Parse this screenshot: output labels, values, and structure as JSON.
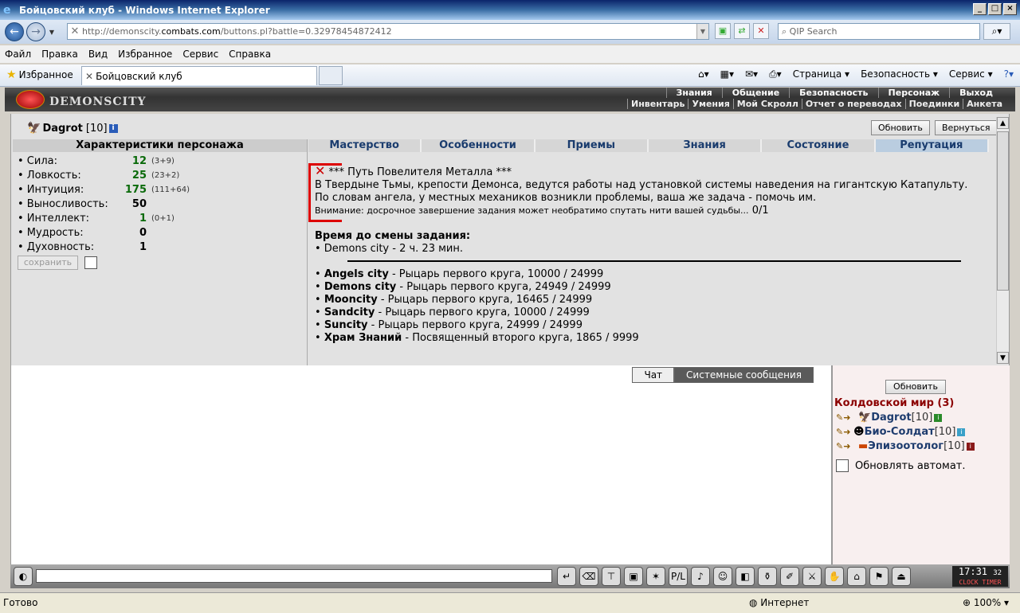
{
  "window": {
    "title": "Бойцовский клуб - Windows Internet Explorer"
  },
  "address": {
    "url_prefix": "http://demonscity.",
    "url_domain": "combats.com",
    "url_path": "/buttons.pl?battle=0.32978454872412",
    "search_placeholder": "QIP Search"
  },
  "menu": [
    "Файл",
    "Правка",
    "Вид",
    "Избранное",
    "Сервис",
    "Справка"
  ],
  "favorites": {
    "label": "Избранное",
    "tab": "Бойцовский клуб"
  },
  "cmdbar": [
    "Страница",
    "Безопасность",
    "Сервис"
  ],
  "game": {
    "logo": "DEMONSCITY",
    "topnav": [
      "Знания",
      "Общение",
      "Безопасность",
      "Персонаж",
      "Выход"
    ],
    "subnav": [
      "Инвентарь",
      "Умения",
      "Мой Скролл",
      "Отчет о переводах",
      "Поединки",
      "Анкета"
    ],
    "char": {
      "name": "Dagrot",
      "level": "[10]",
      "info": "i"
    },
    "refresh": "Обновить",
    "back": "Вернуться",
    "stats_title": "Характеристики персонажа",
    "stats": [
      {
        "name": "• Сила:",
        "value": "12",
        "extra": "(3+9)"
      },
      {
        "name": "• Ловкость:",
        "value": "25",
        "extra": "(23+2)"
      },
      {
        "name": "• Интуиция:",
        "value": "175",
        "extra": "(111+64)"
      },
      {
        "name": "• Выносливость:",
        "value": "50",
        "extra": ""
      },
      {
        "name": "• Интеллект:",
        "value": "1",
        "extra": "(0+1)"
      },
      {
        "name": "• Мудрость:",
        "value": "0",
        "extra": ""
      },
      {
        "name": "• Духовность:",
        "value": "1",
        "extra": ""
      }
    ],
    "save": "сохранить",
    "tabs": [
      "Мастерство",
      "Особенности",
      "Приемы",
      "Знания",
      "Состояние",
      "Репутация"
    ],
    "quest": {
      "title": "*** Путь Повелителя Металла ***",
      "text": "В Твердыне Тьмы, крепости Демонса, ведутся работы над установкой системы наведения на гигантскую Катапульту. По словам ангела, у местных механиков возникли проблемы, ваша же задача - помочь им.",
      "warning": "Внимание: досрочное завершение задания может необратимо спутать нити вашей судьбы...",
      "progress": "0/1"
    },
    "timer_title": "Время до смены задания:",
    "timer_value": "• Demons city - 2 ч. 23 мин.",
    "cities": [
      {
        "name": "Angels city",
        "rest": " - Рыцарь первого круга, 10000 / 24999"
      },
      {
        "name": "Demons city",
        "rest": " - Рыцарь первого круга, 24949 / 24999"
      },
      {
        "name": "Mooncity",
        "rest": " - Рыцарь первого круга, 16465 / 24999"
      },
      {
        "name": "Sandcity",
        "rest": " - Рыцарь первого круга, 10000 / 24999"
      },
      {
        "name": "Suncity",
        "rest": " - Рыцарь первого круга, 24999 / 24999"
      },
      {
        "name": "Храм Знаний",
        "rest": " - Посвященный второго круга, 1865 / 9999"
      }
    ],
    "chat_tabs": [
      "Чат",
      "Системные сообщения"
    ],
    "online": {
      "refresh": "Обновить",
      "title": "Колдовской мир (3)",
      "players": [
        {
          "name": "Dagrot",
          "level": "[10]"
        },
        {
          "name": "Био-Солдат",
          "level": "[10]"
        },
        {
          "name": "Эпизоотолог",
          "level": "[10]"
        }
      ],
      "auto": "Обновлять автомат."
    },
    "clock": {
      "time": "17:31",
      "sec": "32",
      "label": "CLOCK TIMER"
    }
  },
  "status": {
    "text": "Готово",
    "zone": "Интернет",
    "zoom": "100%"
  }
}
